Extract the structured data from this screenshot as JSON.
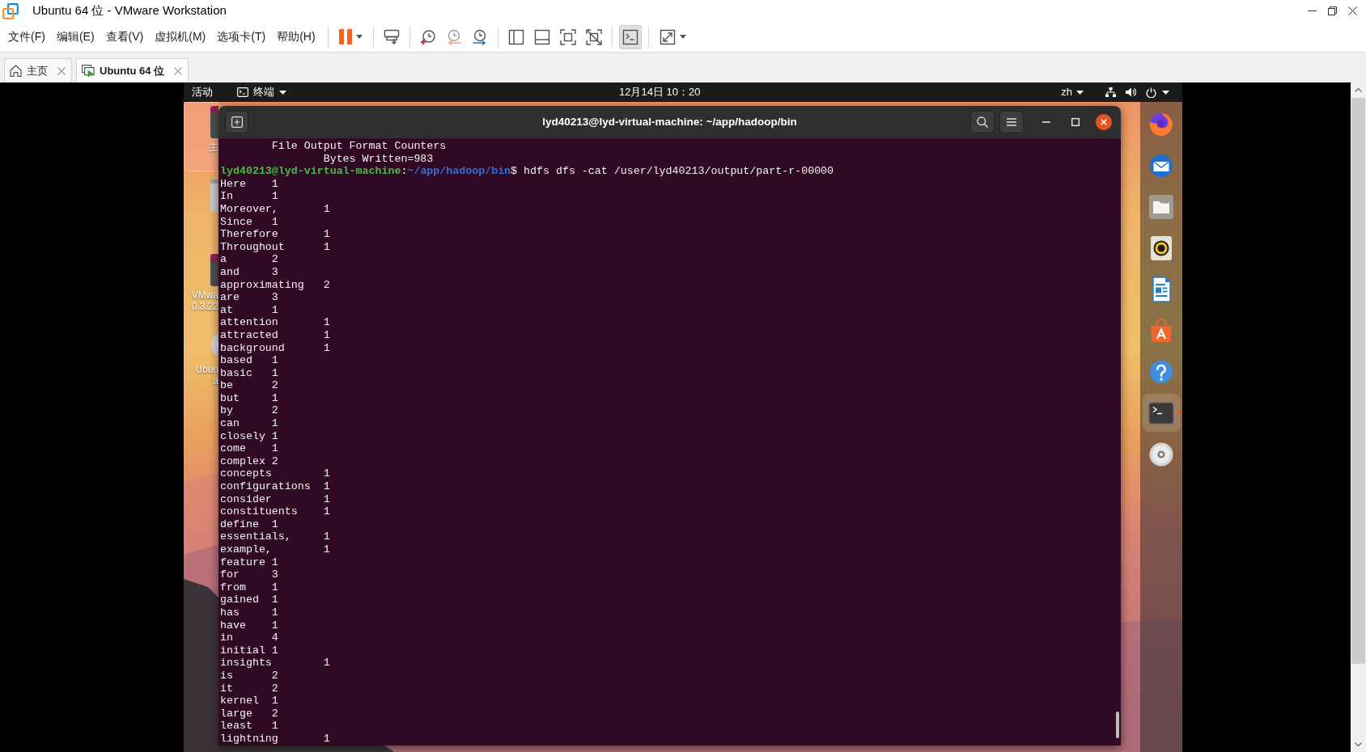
{
  "window": {
    "title": "Ubuntu 64 位 - VMware Workstation"
  },
  "menu_bar": [
    "文件(F)",
    "编辑(E)",
    "查看(V)",
    "虚拟机(M)",
    "选项卡(T)",
    "帮助(H)"
  ],
  "toolbar": [
    {
      "buttons": [
        {
          "kind": "pause",
          "has_menu": true,
          "selected": false
        }
      ]
    },
    {
      "buttons": [
        {
          "kind": "send_keys",
          "has_menu": false,
          "selected": false
        }
      ]
    },
    {
      "buttons": [
        {
          "kind": "snapshot",
          "has_menu": false,
          "selected": false
        },
        {
          "kind": "revert",
          "has_menu": false,
          "selected": false
        },
        {
          "kind": "snapshot_manager",
          "has_menu": false,
          "selected": false
        }
      ]
    },
    {
      "buttons": [
        {
          "kind": "sidebar",
          "has_menu": false,
          "selected": false
        },
        {
          "kind": "thumbnails",
          "has_menu": false,
          "selected": false
        },
        {
          "kind": "full_screen",
          "has_menu": false,
          "selected": false
        },
        {
          "kind": "unity",
          "has_menu": false,
          "selected": false
        }
      ]
    },
    {
      "buttons": [
        {
          "kind": "console",
          "has_menu": false,
          "selected": true
        }
      ]
    },
    {
      "buttons": [
        {
          "kind": "stretch",
          "has_menu": true,
          "selected": false
        }
      ]
    }
  ],
  "tabs": [
    {
      "label": "主页",
      "kind": "home",
      "selected": false
    },
    {
      "label": "Ubuntu 64 位",
      "kind": "vm",
      "selected": true
    }
  ],
  "guest": {
    "top_bar": {
      "activities": "活动",
      "app_menu": "终端",
      "clock": "12月14日 10：20",
      "input_method": "zh"
    },
    "desktop_icons": [
      {
        "kind": "folder",
        "label_lines": [
          "主"
        ],
        "selected": true
      },
      {
        "kind": "trash",
        "selected": false
      },
      {
        "kind": "package",
        "label_lines": [
          "VMwa",
          "0.3.22"
        ],
        "selected": false
      },
      {
        "kind": "disc",
        "label_lines": [
          "Ubun",
          "a"
        ],
        "selected": false
      }
    ],
    "terminal": {
      "title": "lyd40213@lyd-virtual-machine: ~/app/hadoop/bin",
      "lines": [
        {
          "kind": "output",
          "text": "\tFile Output Format Counters"
        },
        {
          "kind": "output",
          "text": "\t\tBytes Written=983"
        },
        {
          "kind": "prompt",
          "segments": [
            {
              "kind": "user",
              "text": "lyd40213@lyd-virtual-machine"
            },
            {
              "kind": "plain",
              "text": ":"
            },
            {
              "kind": "path",
              "text": "~/app/hadoop/bin"
            },
            {
              "kind": "plain",
              "text": "$ hdfs dfs -cat /user/lyd40213/output/part-r-00000"
            }
          ]
        },
        {
          "kind": "output",
          "text": "Here\t1"
        },
        {
          "kind": "output",
          "text": "In\t1"
        },
        {
          "kind": "output",
          "text": "Moreover,\t1"
        },
        {
          "kind": "output",
          "text": "Since\t1"
        },
        {
          "kind": "output",
          "text": "Therefore\t1"
        },
        {
          "kind": "output",
          "text": "Throughout\t1"
        },
        {
          "kind": "output",
          "text": "a\t2"
        },
        {
          "kind": "output",
          "text": "and\t3"
        },
        {
          "kind": "output",
          "text": "approximating\t2"
        },
        {
          "kind": "output",
          "text": "are\t3"
        },
        {
          "kind": "output",
          "text": "at\t1"
        },
        {
          "kind": "output",
          "text": "attention\t1"
        },
        {
          "kind": "output",
          "text": "attracted\t1"
        },
        {
          "kind": "output",
          "text": "background\t1"
        },
        {
          "kind": "output",
          "text": "based\t1"
        },
        {
          "kind": "output",
          "text": "basic\t1"
        },
        {
          "kind": "output",
          "text": "be\t2"
        },
        {
          "kind": "output",
          "text": "but\t1"
        },
        {
          "kind": "output",
          "text": "by\t2"
        },
        {
          "kind": "output",
          "text": "can\t1"
        },
        {
          "kind": "output",
          "text": "closely\t1"
        },
        {
          "kind": "output",
          "text": "come\t1"
        },
        {
          "kind": "output",
          "text": "complex\t2"
        },
        {
          "kind": "output",
          "text": "concepts\t1"
        },
        {
          "kind": "output",
          "text": "configurations\t1"
        },
        {
          "kind": "output",
          "text": "consider\t1"
        },
        {
          "kind": "output",
          "text": "constituents\t1"
        },
        {
          "kind": "output",
          "text": "define\t1"
        },
        {
          "kind": "output",
          "text": "essentials,\t1"
        },
        {
          "kind": "output",
          "text": "example,\t1"
        },
        {
          "kind": "output",
          "text": "feature\t1"
        },
        {
          "kind": "output",
          "text": "for\t3"
        },
        {
          "kind": "output",
          "text": "from\t1"
        },
        {
          "kind": "output",
          "text": "gained\t1"
        },
        {
          "kind": "output",
          "text": "has\t1"
        },
        {
          "kind": "output",
          "text": "have\t1"
        },
        {
          "kind": "output",
          "text": "in\t4"
        },
        {
          "kind": "output",
          "text": "initial\t1"
        },
        {
          "kind": "output",
          "text": "insights\t1"
        },
        {
          "kind": "output",
          "text": "is\t2"
        },
        {
          "kind": "output",
          "text": "it\t2"
        },
        {
          "kind": "output",
          "text": "kernel\t1"
        },
        {
          "kind": "output",
          "text": "large\t2"
        },
        {
          "kind": "output",
          "text": "least\t1"
        },
        {
          "kind": "output",
          "text": "lightning\t1"
        }
      ]
    },
    "dock": [
      {
        "kind": "browser",
        "selected": false,
        "running": false
      },
      {
        "kind": "mail",
        "selected": false,
        "running": false
      },
      {
        "kind": "files",
        "selected": false,
        "running": false
      },
      {
        "kind": "music",
        "selected": false,
        "running": false
      },
      {
        "kind": "writer",
        "selected": false,
        "running": false
      },
      {
        "kind": "software",
        "selected": false,
        "running": false
      },
      {
        "kind": "help",
        "selected": false,
        "running": false
      },
      {
        "kind": "terminal",
        "selected": true,
        "running": true
      },
      {
        "kind": "disc",
        "selected": false,
        "running": false
      }
    ]
  }
}
